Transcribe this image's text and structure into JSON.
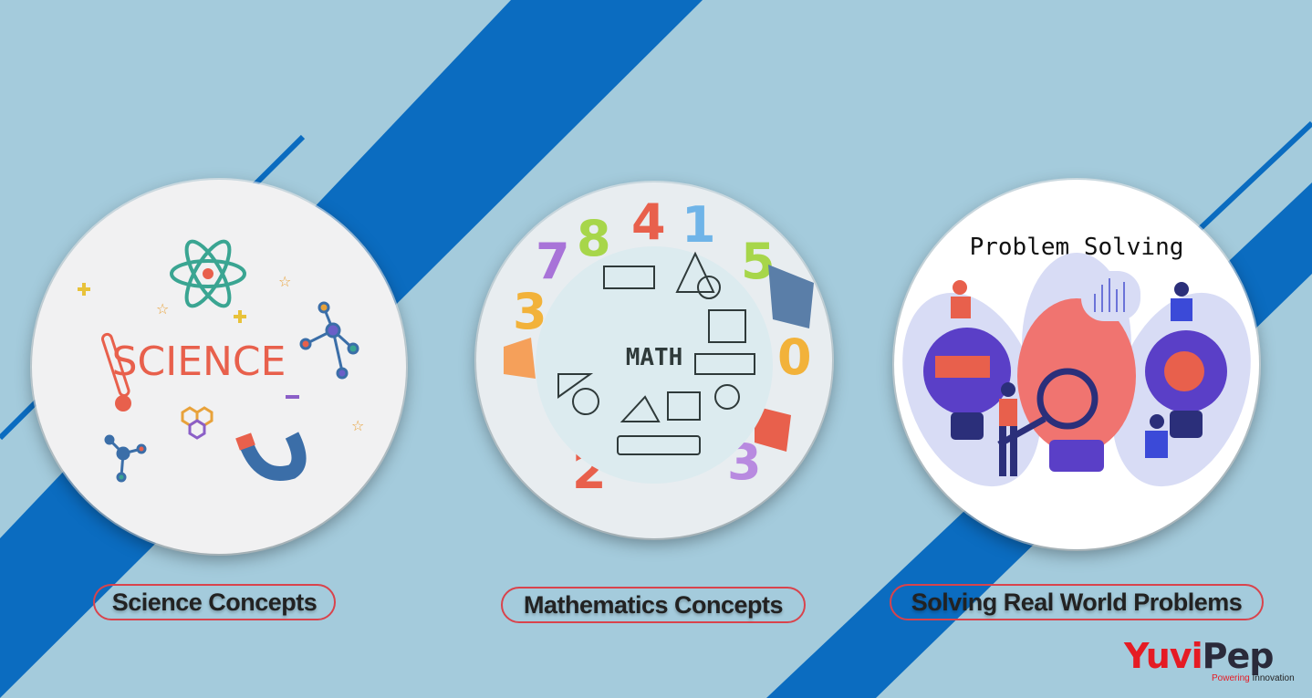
{
  "panels": [
    {
      "circle_title": "SCIENCE",
      "caption": "Science Concepts"
    },
    {
      "circle_title": "MATH",
      "caption": "Mathematics Concepts"
    },
    {
      "circle_title": "Problem Solving",
      "caption": "Solving Real World Problems"
    }
  ],
  "logo": {
    "part1": "Yuvi",
    "part2": "Pep",
    "tagline_part1": "Powering",
    "tagline_part2": " Innovation"
  },
  "colors": {
    "background": "#a4cbdc",
    "stripe": "#0b6cc0",
    "caption_border": "#d9434c",
    "logo_red": "#e51b24"
  }
}
